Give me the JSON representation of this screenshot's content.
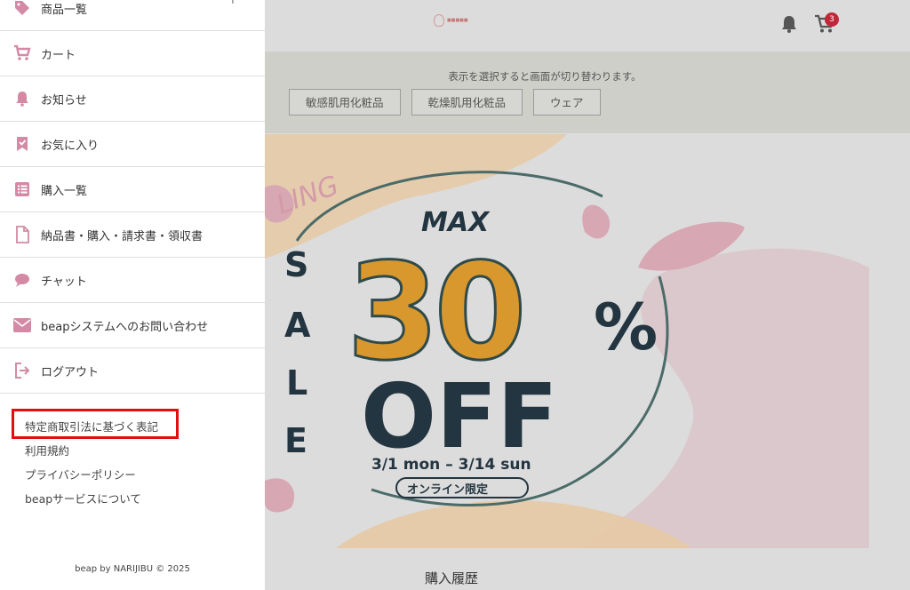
{
  "drawer": {
    "items": [
      {
        "label": "商品一覧",
        "icon": "tag-icon",
        "expand": "+"
      },
      {
        "label": "カート",
        "icon": "cart-icon"
      },
      {
        "label": "お知らせ",
        "icon": "bell-icon"
      },
      {
        "label": "お気に入り",
        "icon": "bookmark-check-icon"
      },
      {
        "label": "購入一覧",
        "icon": "list-icon"
      },
      {
        "label": "納品書・購入・請求書・領収書",
        "icon": "document-icon"
      },
      {
        "label": "チャット",
        "icon": "chat-bubble-icon"
      },
      {
        "label": "beapシステムへのお問い合わせ",
        "icon": "mail-icon"
      },
      {
        "label": "ログアウト",
        "icon": "logout-icon"
      }
    ],
    "links": [
      "特定商取引法に基づく表記",
      "利用規約",
      "プライバシーポリシー",
      "beapサービスについて"
    ],
    "copyright": "beap by NARIJIBU © 2025"
  },
  "header": {
    "cart_count": "3"
  },
  "filter": {
    "note": "表示を選択すると画面が切り替わります。",
    "buttons": [
      "敏感肌用化粧品",
      "乾燥肌用化粧品",
      "ウェア"
    ]
  },
  "banner": {
    "arc_text": "LING",
    "max": "MAX",
    "percent": "30",
    "percent_sign": "%",
    "off": "OFF",
    "sale_letters": [
      "S",
      "A",
      "L",
      "E"
    ],
    "dates": "3/1 mon – 3/14 sun",
    "online_badge": "オンライン限定"
  },
  "section_title": "購入履歴",
  "colors": {
    "accent_pink": "#d48aa5",
    "highlight_red": "#e01010",
    "badge_red": "#c0283a",
    "sale_orange": "#d9982e",
    "navy": "#233540"
  }
}
